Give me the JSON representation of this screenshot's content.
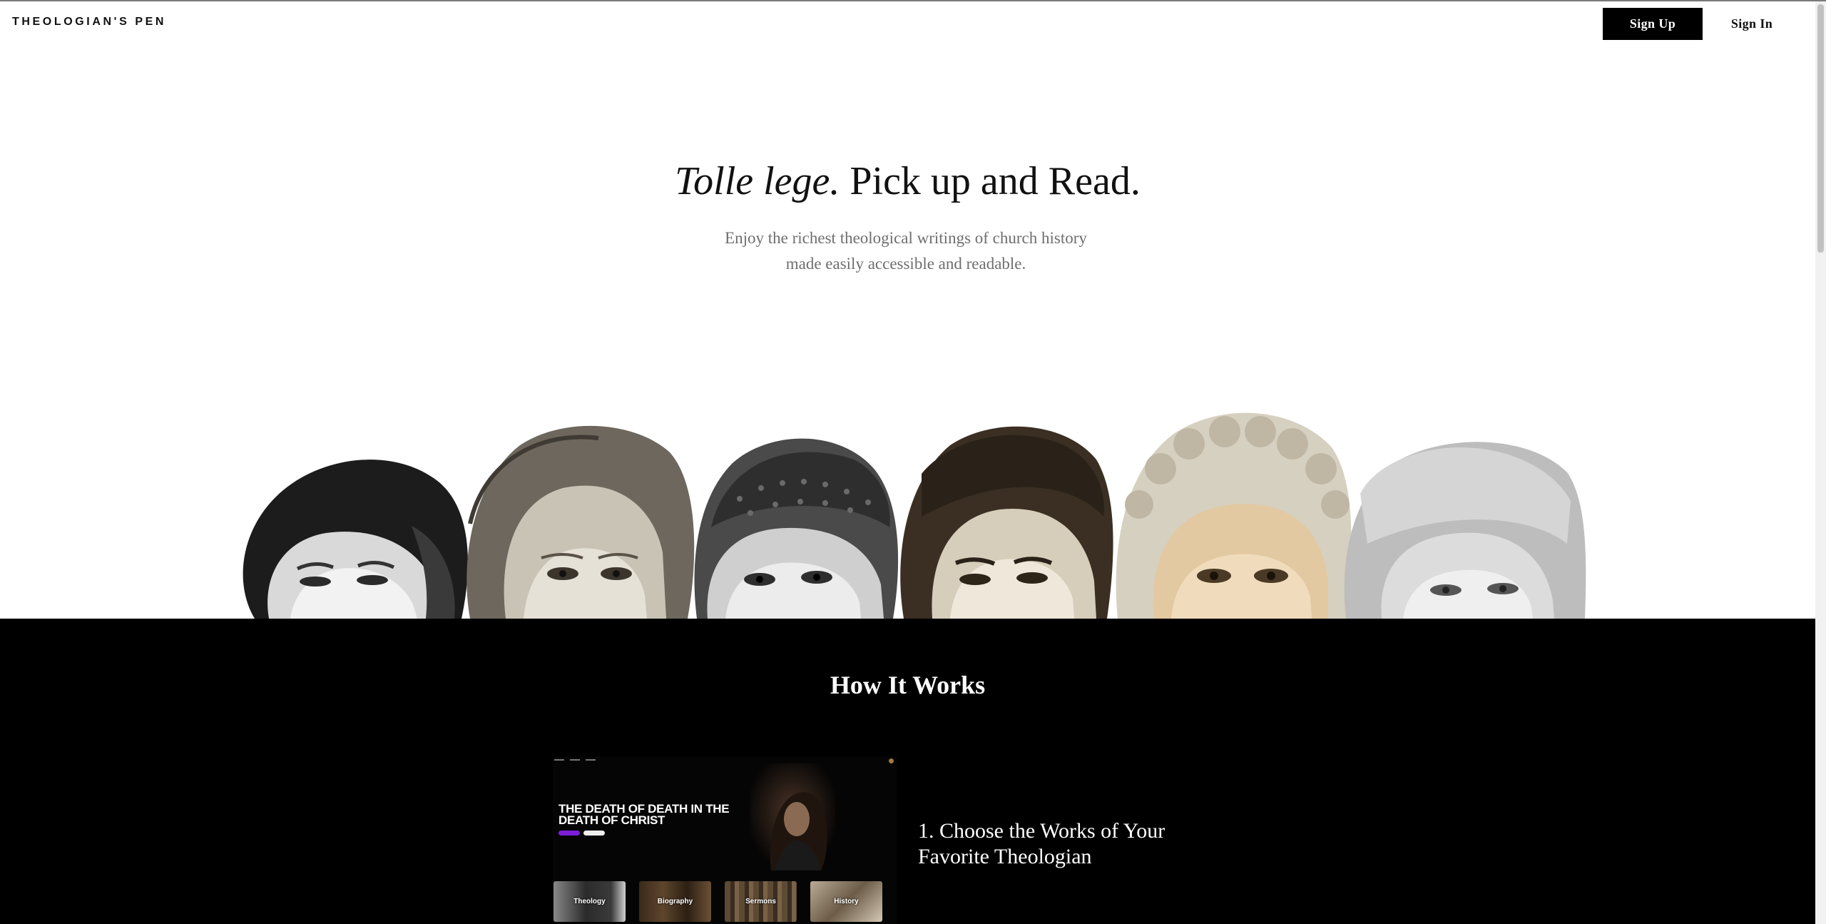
{
  "header": {
    "logo": "THEOLOGIAN'S PEN",
    "signup_label": "Sign Up",
    "signin_label": "Sign In"
  },
  "hero": {
    "title_italic": "Tolle lege.",
    "title_rest": " Pick up and Read.",
    "subtitle_line1": "Enjoy the richest theological writings of church history",
    "subtitle_line2": "made easily accessible and readable."
  },
  "portraits": [
    {
      "icon": "portrait-1"
    },
    {
      "icon": "portrait-2"
    },
    {
      "icon": "portrait-3"
    },
    {
      "icon": "portrait-4"
    },
    {
      "icon": "portrait-5"
    },
    {
      "icon": "portrait-6"
    }
  ],
  "how_it_works": {
    "title": "How It Works",
    "preview": {
      "book_title": "THE DEATH OF DEATH IN THE DEATH OF CHRIST",
      "categories": [
        "Theology",
        "Biography",
        "Sermons",
        "History"
      ]
    },
    "step": "1. Choose the Works of Your Favorite Theologian"
  },
  "colors": {
    "accent_black": "#000000",
    "hero_sub_gray": "#6e6e6e",
    "pill_purple": "#7c1dd8"
  }
}
